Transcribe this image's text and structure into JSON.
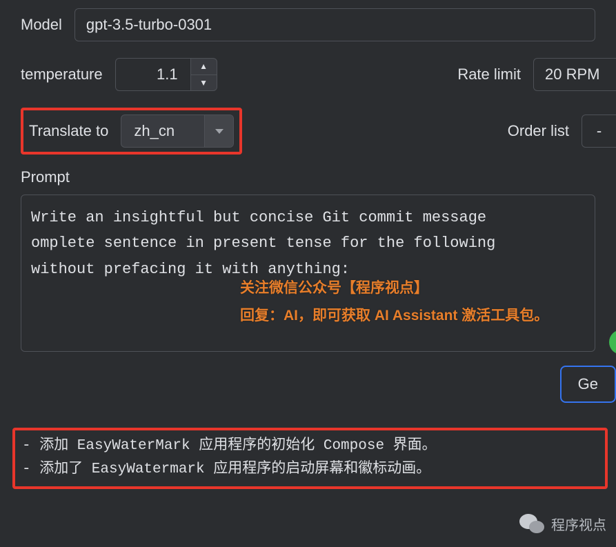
{
  "model": {
    "label": "Model",
    "value": "gpt-3.5-turbo-0301"
  },
  "temperature": {
    "label": "temperature",
    "value": "1.1"
  },
  "rate_limit": {
    "label": "Rate limit",
    "value": "20 RPM"
  },
  "translate_to": {
    "label": "Translate to",
    "value": "zh_cn"
  },
  "order_list": {
    "label": "Order list",
    "value": "-"
  },
  "prompt": {
    "label": "Prompt",
    "text": "Write an insightful but concise Git commit message \nomplete sentence in present tense for the following\nwithout prefacing it with anything:"
  },
  "overlay": {
    "line1": "关注微信公众号【程序视点】",
    "line2": "回复：AI，即可获取 AI Assistant 激活工具包。"
  },
  "generate_button": "Ge",
  "output": {
    "line1": "- 添加 EasyWaterMark 应用程序的初始化 Compose 界面。",
    "line2": "- 添加了 EasyWatermark 应用程序的启动屏幕和徽标动画。"
  },
  "wechat": {
    "label": "程序视点"
  }
}
